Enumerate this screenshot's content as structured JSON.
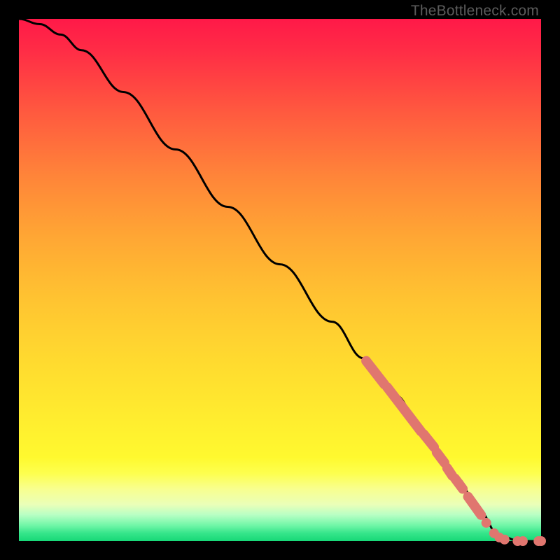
{
  "watermark": "TheBottleneck.com",
  "chart_data": {
    "type": "line",
    "title": "",
    "xlabel": "",
    "ylabel": "",
    "xlim": [
      0,
      100
    ],
    "ylim": [
      0,
      100
    ],
    "curve": {
      "name": "main-curve",
      "x": [
        0,
        4,
        8,
        12,
        20,
        30,
        40,
        50,
        60,
        66,
        72,
        78,
        84,
        88,
        92,
        96,
        100
      ],
      "y": [
        100,
        99,
        97,
        94,
        86,
        75,
        64,
        53,
        42,
        35,
        28,
        20,
        12,
        6,
        1,
        0,
        0
      ]
    },
    "highlight_segments": [
      {
        "x0": 66.5,
        "y0": 34.5,
        "x1": 70.0,
        "y1": 30.0
      },
      {
        "x0": 70.5,
        "y0": 29.5,
        "x1": 77.0,
        "y1": 21.0
      },
      {
        "x0": 77.5,
        "y0": 20.5,
        "x1": 79.5,
        "y1": 18.0
      },
      {
        "x0": 80.0,
        "y0": 17.0,
        "x1": 81.5,
        "y1": 15.0
      },
      {
        "x0": 82.0,
        "y0": 14.0,
        "x1": 83.0,
        "y1": 12.5
      },
      {
        "x0": 83.5,
        "y0": 12.0,
        "x1": 85.0,
        "y1": 10.0
      },
      {
        "x0": 86.0,
        "y0": 8.5,
        "x1": 88.5,
        "y1": 5.0
      }
    ],
    "highlight_dots": [
      {
        "x": 89.5,
        "y": 3.5
      },
      {
        "x": 91.0,
        "y": 1.5
      },
      {
        "x": 92.0,
        "y": 0.7
      },
      {
        "x": 93.0,
        "y": 0.3
      },
      {
        "x": 95.5,
        "y": 0.0
      },
      {
        "x": 96.5,
        "y": 0.0
      },
      {
        "x": 99.5,
        "y": 0.0
      },
      {
        "x": 100.0,
        "y": 0.0
      }
    ],
    "colors": {
      "curve": "#000000",
      "highlight": "#e0766f"
    }
  }
}
